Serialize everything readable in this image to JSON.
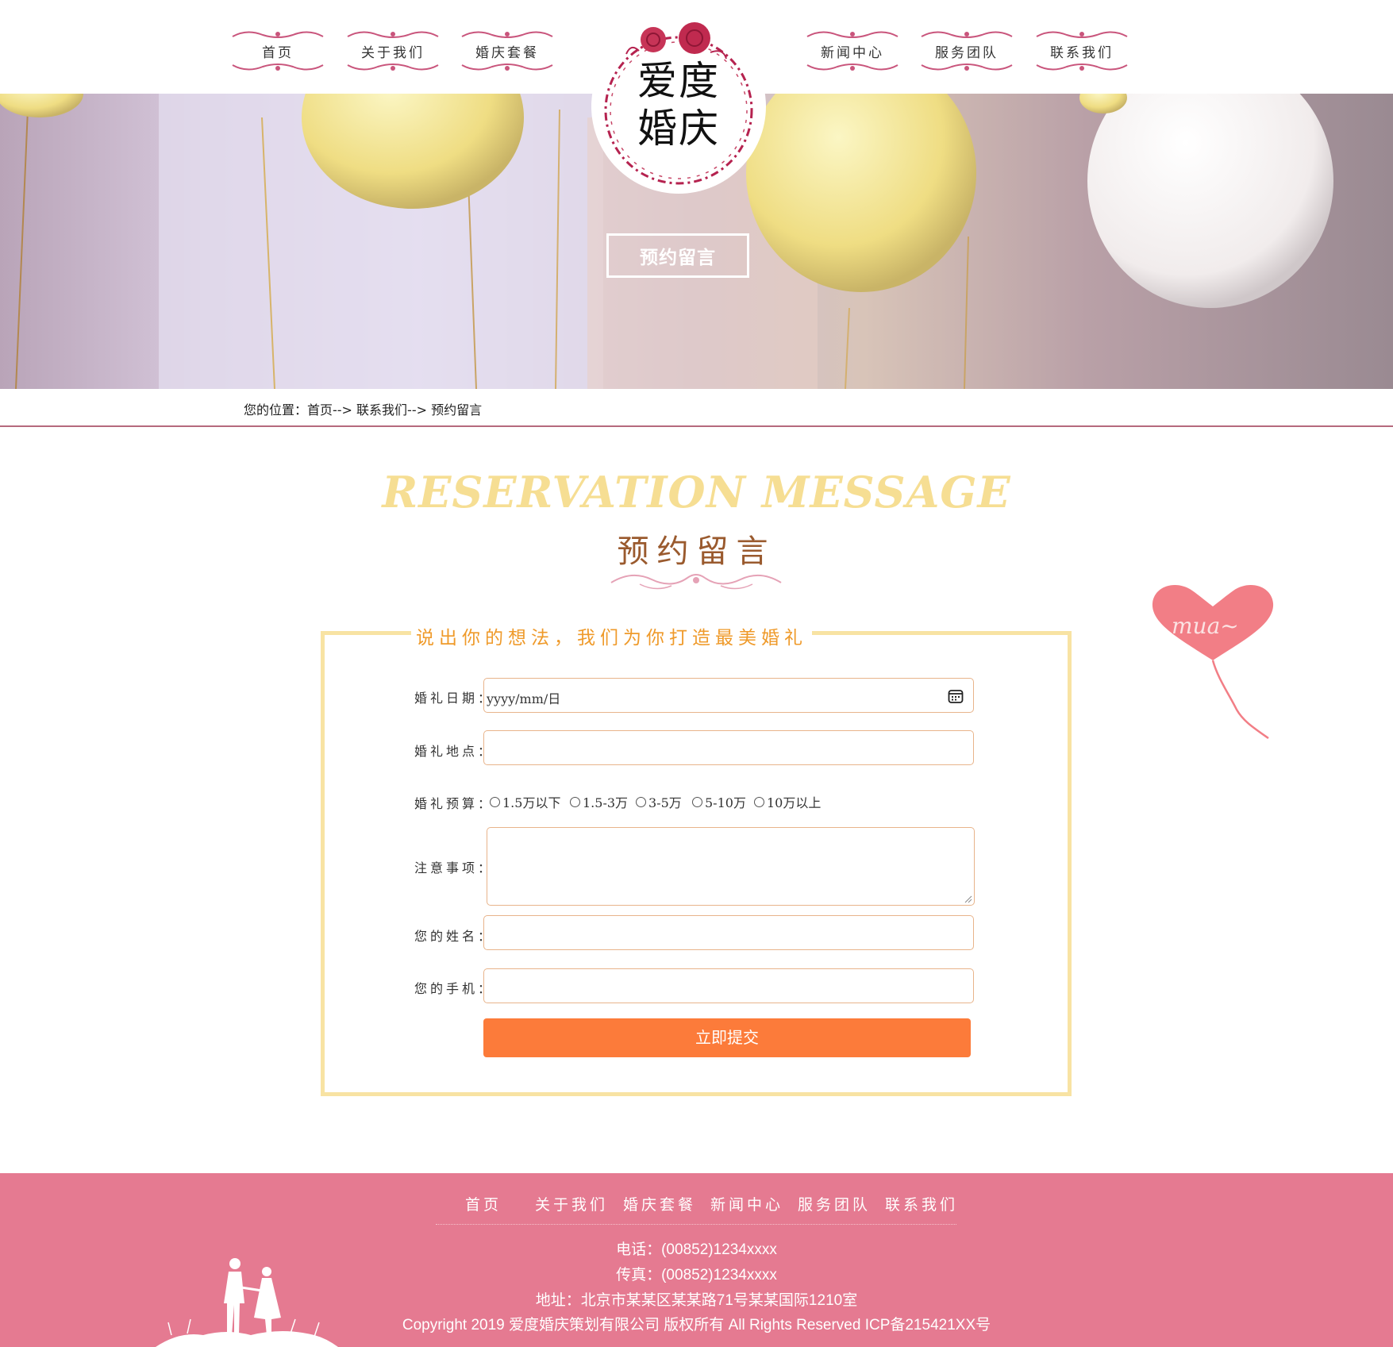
{
  "nav": {
    "left": [
      {
        "label": "首页"
      },
      {
        "label": "关于我们"
      },
      {
        "label": "婚庆套餐"
      }
    ],
    "right": [
      {
        "label": "新闻中心"
      },
      {
        "label": "服务团队"
      },
      {
        "label": "联系我们"
      }
    ]
  },
  "logo": {
    "line1": "爱度",
    "line2": "婚庆"
  },
  "banner": {
    "title": "预约留言"
  },
  "breadcrumb": {
    "text": "您的位置：首页--> 联系我们--> 预约留言"
  },
  "section": {
    "title_en": "RESERVATION MESSAGE",
    "title_cn": "预约留言"
  },
  "form": {
    "legend": "说出你的想法，我们为你打造最美婚礼",
    "date_label": "婚礼日期：",
    "date_placeholder": "yyyy/mm/日",
    "place_label": "婚礼地点：",
    "budget_label": "婚礼预算：",
    "budget_options": [
      "1.5万以下",
      "1.5-3万",
      "3-5万",
      "5-10万",
      "10万以上"
    ],
    "notes_label": "注意事项：",
    "name_label": "您的姓名：",
    "phone_label": "您的手机：",
    "submit": "立即提交"
  },
  "heart_text": "mua~",
  "footer": {
    "nav": [
      "首页",
      "关于我们",
      "婚庆套餐",
      "新闻中心",
      "服务团队",
      "联系我们"
    ],
    "phone": "电话：(00852)1234xxxx",
    "fax": "传真：(00852)1234xxxx",
    "address": "地址：北京市某某区某某路71号某某国际1210室",
    "copyright": "Copyright 2019 爱度婚庆策划有限公司 版权所有 All Rights Reserved ICP备215421XX号"
  },
  "colors": {
    "accent_pink": "#e57a91",
    "submit_orange": "#fc7b3a",
    "legend_orange": "#ef9a2a",
    "form_border": "#f8e3a3",
    "title_gold": "#f6de93"
  }
}
